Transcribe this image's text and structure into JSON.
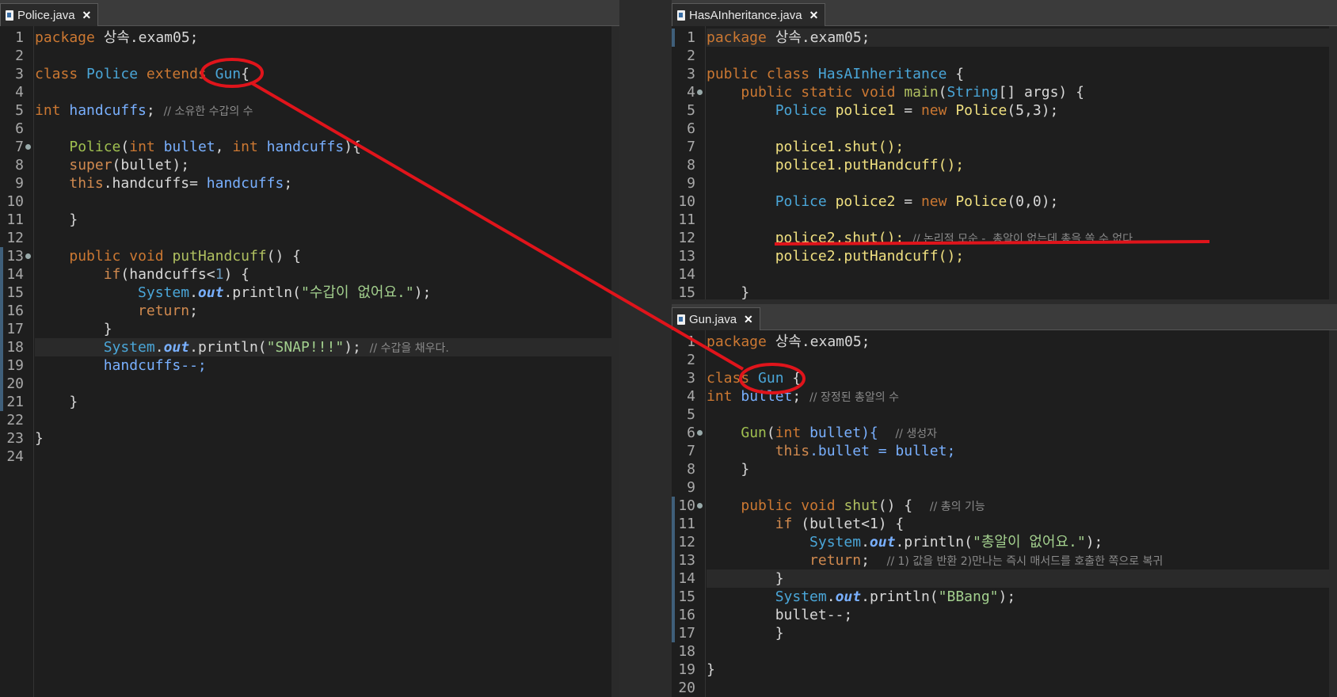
{
  "tabs": {
    "police": "Police.java",
    "has": "HasAInheritance.java",
    "gun": "Gun.java",
    "close": "✕"
  },
  "police_lines": [
    "1",
    "2",
    "3",
    "4",
    "5",
    "6",
    "7",
    "8",
    "9",
    "10",
    "11",
    "12",
    "13",
    "14",
    "15",
    "16",
    "17",
    "18",
    "19",
    "20",
    "21",
    "22",
    "23",
    "24"
  ],
  "has_lines": [
    "1",
    "2",
    "3",
    "4",
    "5",
    "6",
    "7",
    "8",
    "9",
    "10",
    "11",
    "12",
    "13",
    "14",
    "15"
  ],
  "gun_lines": [
    "1",
    "2",
    "3",
    "4",
    "5",
    "6",
    "7",
    "8",
    "9",
    "10",
    "11",
    "12",
    "13",
    "14",
    "15",
    "16",
    "17",
    "18",
    "19",
    "20"
  ],
  "police": {
    "pkg_kw": "package",
    "pkg": " 상속.exam05;",
    "cls_kw": "class",
    "cls_name": "Police",
    "ext_kw": "extends",
    "gun": "Gun",
    "brace": "{",
    "int_kw": "int",
    "handcuffs": "handcuffs",
    "semi": ";",
    "cm_handcuffs": "// 소유한 수갑의 수",
    "ctor": "Police",
    "p_open": "(",
    "int2": "int",
    "bullet": "bullet",
    "comma": ", ",
    "int3": "int",
    "handcuffs_p": "handcuffs",
    "p_close": "){",
    "super": "super",
    "super_args": "(bullet);",
    "this": "this",
    "this_rest": ".handcuffs= ",
    "handcuffs_r": "handcuffs",
    "semi2": ";",
    "close1": "}",
    "pub": "public",
    "void": "void",
    "put": "putHandcuff",
    "put_rest": "() {",
    "if": "if",
    "if_rest": "(handcuffs<",
    "one": "1",
    "if_end": ") {",
    "sys": "System",
    "out": "out",
    "println": "println",
    "str1": "\"수갑이 없어요.\"",
    "pend": ");",
    "ret": "return",
    "semi3": ";",
    "close2": "}",
    "str2": "\"SNAP!!!\"",
    "cm_snap": "// 수갑을 채우다.",
    "dec": "handcuffs--;",
    "close3": "}",
    "close4": "}"
  },
  "has": {
    "pkg_kw": "package",
    "pkg": " 상속.exam05;",
    "pub": "public",
    "cls": "class",
    "name": "HasAInheritance",
    "brace": " {",
    "pub2": "public",
    "static": "static",
    "void": "void",
    "main": "main",
    "string": "String",
    "args_rest": "[] args) {",
    "police_t": "Police",
    "police1": "police1",
    "eq": " = ",
    "new": "new",
    "police_c": "Police",
    "args1": "(5,3);",
    "shut1": "police1.shut();",
    "put1": "police1.putHandcuff();",
    "police_t2": "Police",
    "police2": "police2",
    "args2": "(0,0);",
    "shut2": "police2.shut();",
    "cm_shut2": "// 논리적 모순 -  총알이 없는데 총을 쏠 수 없다.",
    "put2": "police2.putHandcuff();",
    "close": "}"
  },
  "gun": {
    "pkg_kw": "package",
    "pkg": " 상속.exam05;",
    "cls_kw": "class",
    "name": "Gun",
    "brace": " {",
    "int_kw": "int",
    "bullet": "bullet",
    "semi": ";",
    "cm_bullet": "// 장정된 총알의 수",
    "ctor": "Gun",
    "ctor_int": "int",
    "ctor_rest": "bullet){",
    "cm_ctor": "// 생성자",
    "this": "this",
    "this_rest": ".bullet = bullet;",
    "close1": "}",
    "pub": "public",
    "void": "void",
    "shut": "shut",
    "shut_rest": "() {",
    "cm_shut": "// 총의 기능",
    "if": "if",
    "if_rest": " (bullet<1) {",
    "str1": "\"총알이 없어요.\"",
    "pend": ");",
    "ret": "return",
    "semi2": ";",
    "cm_ret": "// 1) 값을 반환 2)만나는 즉시 매서드를 호출한 쪽으로 복귀",
    "close2": "}",
    "str2": "\"BBang\"",
    "dec": "bullet--;",
    "close3": "}",
    "close4": "}"
  },
  "annotation_color": "#e0141b"
}
